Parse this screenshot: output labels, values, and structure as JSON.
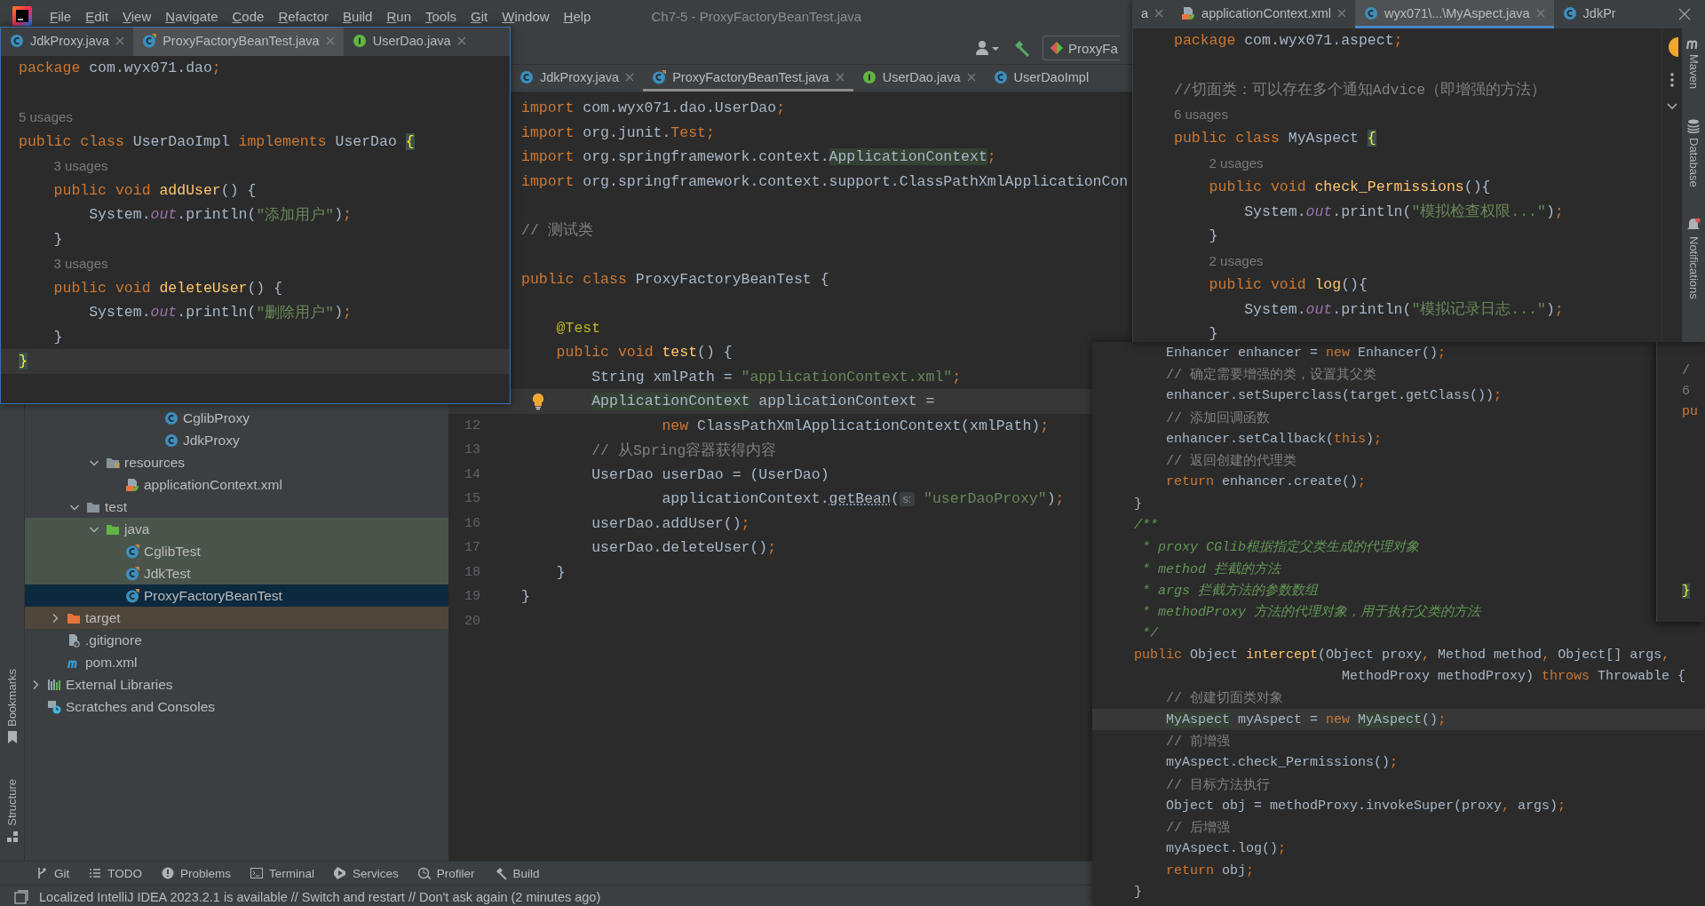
{
  "menu_bar": {
    "items": [
      "File",
      "Edit",
      "View",
      "Navigate",
      "Code",
      "Refactor",
      "Build",
      "Run",
      "Tools",
      "Git",
      "Window",
      "Help"
    ],
    "title": "Ch7-5 - ProxyFactoryBeanTest.java"
  },
  "toolbar": {
    "run_config": "ProxyFa"
  },
  "project_tree": [
    {
      "children": [
        {
          "children": [
            {
              "children": [
                {
                  "children": [
                    {
                      "children": [
                        {
                          "children": [
                            {
                              "label": "CglibProxy",
                              "kind": "class",
                              "selected": false
                            },
                            {
                              "label": "JdkProxy",
                              "kind": "class",
                              "selected": false
                            }
                          ]
                        }
                      ]
                    }
                  ]
                },
                {
                  "label": "resources",
                  "kind": "res-folder",
                  "expanded": true,
                  "selected": false,
                  "children": [
                    {
                      "label": "applicationContext.xml",
                      "kind": "xml",
                      "selected": false
                    }
                  ]
                }
              ]
            },
            {
              "label": "test",
              "kind": "folder",
              "expanded": true,
              "selected": false,
              "children": [
                {
                  "label": "java",
                  "kind": "test-folder",
                  "expanded": true,
                  "selected": false,
                  "children": [
                    {
                      "label": "CglibTest",
                      "kind": "test-class",
                      "selected": false
                    },
                    {
                      "label": "JdkTest",
                      "kind": "test-class",
                      "selected": false
                    },
                    {
                      "label": "ProxyFactoryBeanTest",
                      "kind": "test-class",
                      "selected": true
                    }
                  ]
                }
              ]
            }
          ]
        },
        {
          "label": "target",
          "kind": "excluded-folder",
          "expanded": false,
          "selected": false
        },
        {
          "label": ".gitignore",
          "kind": "ignore",
          "selected": false
        },
        {
          "label": "pom.xml",
          "kind": "maven",
          "selected": false
        }
      ]
    },
    {
      "label": "External Libraries",
      "kind": "libs",
      "expanded": false,
      "selected": false
    },
    {
      "label": "Scratches and Consoles",
      "kind": "scratch",
      "selected": false
    }
  ],
  "main_editor": {
    "tabs": [
      {
        "label": "JdkProxy.java",
        "kind": "class",
        "selected": false,
        "closable": true
      },
      {
        "label": "ProxyFactoryBeanTest.java",
        "kind": "test-class",
        "selected": true,
        "closable": true
      },
      {
        "label": "UserDao.java",
        "kind": "interface",
        "selected": false,
        "closable": true
      },
      {
        "label": "UserDaoImpl",
        "kind": "class",
        "selected": false,
        "closable": false
      }
    ],
    "lines": [
      {
        "t": [
          {
            "kind": "keyword",
            "text": "import "
          },
          {
            "kind": "plain",
            "text": "com.wyx071.dao.UserDao"
          },
          {
            "kind": "keyword",
            "text": ";"
          }
        ],
        "current": false
      },
      {
        "t": [
          {
            "kind": "keyword",
            "text": "import "
          },
          {
            "kind": "plain",
            "text": "org.junit."
          },
          {
            "kind": "keyword",
            "text": "Test"
          },
          {
            "kind": "keyword",
            "text": ";"
          }
        ],
        "current": false
      },
      {
        "t": [
          {
            "kind": "keyword",
            "text": "import "
          },
          {
            "kind": "plain",
            "text": "org.springframework.context."
          },
          {
            "kind": "highlight",
            "text": "ApplicationContext"
          },
          {
            "kind": "keyword",
            "text": ";"
          }
        ],
        "current": false
      },
      {
        "t": [
          {
            "kind": "keyword",
            "text": "import "
          },
          {
            "kind": "plain",
            "text": "org.springframework.context.support.ClassPathXmlApplicationCon"
          }
        ],
        "current": false
      },
      {
        "current": false
      },
      {
        "t": [
          {
            "kind": "comment",
            "text": "// 测试类"
          }
        ],
        "current": false
      },
      {
        "current": false
      },
      {
        "t": [
          {
            "kind": "keyword",
            "text": "public class "
          },
          {
            "kind": "plain",
            "text": "ProxyFactoryBeanTest {"
          }
        ],
        "current": false
      },
      {
        "current": false
      },
      {
        "t": [
          {
            "kind": "annotation",
            "text": "    @Test"
          }
        ],
        "current": false
      },
      {
        "t": [
          {
            "kind": "keyword",
            "text": "    public void "
          },
          {
            "kind": "function",
            "text": "test"
          },
          {
            "kind": "plain",
            "text": "() {"
          }
        ],
        "current": false
      },
      {
        "t": [
          {
            "kind": "plain",
            "text": "        String xmlPath = "
          },
          {
            "kind": "string",
            "text": "\"applicationContext.xml\""
          },
          {
            "kind": "keyword",
            "text": ";"
          }
        ],
        "current": false
      },
      {
        "t": [
          {
            "kind": "highlight",
            "text": "        ApplicationContext"
          },
          {
            "kind": "plain",
            "text": " applicationContext ="
          }
        ],
        "current": true
      },
      {
        "number": "12",
        "t": [
          {
            "kind": "keyword",
            "text": "                new "
          },
          {
            "kind": "plain",
            "text": "ClassPathXmlApplicationContext(xmlPath)"
          },
          {
            "kind": "keyword",
            "text": ";"
          }
        ],
        "current": false
      },
      {
        "number": "13",
        "t": [
          {
            "kind": "comment",
            "text": "        // 从Spring容器获得内容"
          }
        ],
        "current": false
      },
      {
        "number": "14",
        "t": [
          {
            "kind": "plain",
            "text": "        UserDao userDao = (UserDao)"
          }
        ],
        "current": false
      },
      {
        "number": "15",
        "t": [
          {
            "kind": "plain",
            "text": "                applicationContext."
          },
          {
            "kind": "warning",
            "text": "getBean"
          },
          {
            "kind": "plain",
            "text": "("
          },
          {
            "kind": "hint",
            "text": "s:"
          },
          {
            "kind": "string",
            "text": " \"userDaoProxy\""
          },
          {
            "kind": "plain",
            "text": ")"
          },
          {
            "kind": "keyword",
            "text": ";"
          }
        ],
        "current": false
      },
      {
        "number": "16",
        "t": [
          {
            "kind": "plain",
            "text": "        userDao.addUser()"
          },
          {
            "kind": "keyword",
            "text": ";"
          }
        ],
        "current": false
      },
      {
        "number": "17",
        "t": [
          {
            "kind": "plain",
            "text": "        userDao.deleteUser()"
          },
          {
            "kind": "keyword",
            "text": ";"
          }
        ],
        "current": false
      },
      {
        "number": "18",
        "t": [
          {
            "kind": "plain",
            "text": "    }"
          }
        ],
        "current": false
      },
      {
        "number": "19",
        "t": [
          {
            "kind": "plain",
            "text": "}"
          }
        ],
        "current": false
      },
      {
        "number": "20",
        "current": false
      }
    ]
  },
  "left_strip": [
    "Bookmarks",
    "Structure"
  ],
  "tool_windows": [
    {
      "label": "Git",
      "kind": "git"
    },
    {
      "label": "TODO",
      "kind": "todo"
    },
    {
      "label": "Problems",
      "kind": "problems"
    },
    {
      "label": "Terminal",
      "kind": "terminal"
    },
    {
      "label": "Services",
      "kind": "services"
    },
    {
      "label": "Profiler",
      "kind": "profiler"
    },
    {
      "label": "Build",
      "kind": "build"
    }
  ],
  "status_bar": {
    "message": "Localized IntelliJ IDEA 2023.2.1 is available // Switch and restart // Don't ask again (2 minutes ago)"
  },
  "dao_window": {
    "tabs": [
      {
        "label": "JdkProxy.java",
        "kind": "class",
        "selected": false,
        "closable": true
      },
      {
        "label": "ProxyFactoryBeanTest.java",
        "kind": "test-class",
        "selected": true,
        "closable": true
      },
      {
        "label": "UserDao.java",
        "kind": "interface",
        "selected": false,
        "closable": true
      }
    ],
    "lines": [
      {
        "t": [
          {
            "kind": "keyword",
            "text": "package "
          },
          {
            "kind": "plain",
            "text": "com.wyx071.dao"
          },
          {
            "kind": "keyword",
            "text": ";"
          }
        ],
        "current": false
      },
      {
        "current": false
      },
      {
        "t": [
          {
            "kind": "usages",
            "text": "5 usages"
          }
        ],
        "current": false
      },
      {
        "t": [
          {
            "kind": "keyword",
            "text": "public class "
          },
          {
            "kind": "plain",
            "text": "UserDaoImpl "
          },
          {
            "kind": "keyword",
            "text": "implements "
          },
          {
            "kind": "plain",
            "text": "UserDao "
          },
          {
            "kind": "brace",
            "text": "{"
          }
        ],
        "current": false
      },
      {
        "t": [
          {
            "kind": "usages",
            "text": "    3 usages"
          }
        ],
        "current": false
      },
      {
        "t": [
          {
            "kind": "keyword",
            "text": "    public void "
          },
          {
            "kind": "function",
            "text": "addUser"
          },
          {
            "kind": "plain",
            "text": "() {"
          }
        ],
        "current": false
      },
      {
        "t": [
          {
            "kind": "plain",
            "text": "        System."
          },
          {
            "kind": "field",
            "text": "out"
          },
          {
            "kind": "plain",
            "text": ".println("
          },
          {
            "kind": "string",
            "text": "\"添加用户\""
          },
          {
            "kind": "plain",
            "text": ")"
          },
          {
            "kind": "keyword",
            "text": ";"
          }
        ],
        "current": false
      },
      {
        "t": [
          {
            "kind": "plain",
            "text": "    }"
          }
        ],
        "current": false
      },
      {
        "t": [
          {
            "kind": "usages",
            "text": "    3 usages"
          }
        ],
        "current": false
      },
      {
        "t": [
          {
            "kind": "keyword",
            "text": "    public void "
          },
          {
            "kind": "function",
            "text": "deleteUser"
          },
          {
            "kind": "plain",
            "text": "() {"
          }
        ],
        "current": false
      },
      {
        "t": [
          {
            "kind": "plain",
            "text": "        System."
          },
          {
            "kind": "field",
            "text": "out"
          },
          {
            "kind": "plain",
            "text": ".println("
          },
          {
            "kind": "string",
            "text": "\"删除用户\""
          },
          {
            "kind": "plain",
            "text": ")"
          },
          {
            "kind": "keyword",
            "text": ";"
          }
        ],
        "current": false
      },
      {
        "t": [
          {
            "kind": "plain",
            "text": "    }"
          }
        ],
        "current": false
      },
      {
        "t": [
          {
            "kind": "brace",
            "text": "}"
          }
        ],
        "current": true
      }
    ]
  },
  "aspect_window": {
    "tabs": [
      {
        "label": "a",
        "kind": "none",
        "selected": false,
        "closable": true
      },
      {
        "label": "applicationContext.xml",
        "kind": "xml",
        "selected": false,
        "closable": true
      },
      {
        "label": "wyx071\\...\\MyAspect.java",
        "kind": "class",
        "selected": true,
        "closable": true
      },
      {
        "label": "JdkPr",
        "kind": "class",
        "selected": false,
        "closable": false
      }
    ],
    "lines": [
      {
        "t": [
          {
            "kind": "keyword",
            "text": "package "
          },
          {
            "kind": "plain",
            "text": "com.wyx071.aspect"
          },
          {
            "kind": "keyword",
            "text": ";"
          }
        ],
        "current": false
      },
      {
        "current": false
      },
      {
        "t": [
          {
            "kind": "comment",
            "text": "//切面类：可以存在多个通知Advice（即增强的方法）"
          }
        ],
        "current": false
      },
      {
        "t": [
          {
            "kind": "usages",
            "text": "6 usages"
          }
        ],
        "current": false
      },
      {
        "t": [
          {
            "kind": "keyword",
            "text": "public class "
          },
          {
            "kind": "plain",
            "text": "MyAspect "
          },
          {
            "kind": "brace",
            "text": "{"
          }
        ],
        "current": false
      },
      {
        "t": [
          {
            "kind": "usages",
            "text": "    2 usages"
          }
        ],
        "current": false
      },
      {
        "t": [
          {
            "kind": "keyword",
            "text": "    public void "
          },
          {
            "kind": "function",
            "text": "check_Permissions"
          },
          {
            "kind": "plain",
            "text": "(){"
          }
        ],
        "current": false
      },
      {
        "t": [
          {
            "kind": "plain",
            "text": "        System."
          },
          {
            "kind": "field",
            "text": "out"
          },
          {
            "kind": "plain",
            "text": ".println("
          },
          {
            "kind": "string",
            "text": "\"模拟检查权限...\""
          },
          {
            "kind": "plain",
            "text": ")"
          },
          {
            "kind": "keyword",
            "text": ";"
          }
        ],
        "current": false
      },
      {
        "t": [
          {
            "kind": "plain",
            "text": "    }"
          }
        ],
        "current": false
      },
      {
        "t": [
          {
            "kind": "usages",
            "text": "    2 usages"
          }
        ],
        "current": false
      },
      {
        "t": [
          {
            "kind": "keyword",
            "text": "    public void "
          },
          {
            "kind": "function",
            "text": "log"
          },
          {
            "kind": "plain",
            "text": "(){"
          }
        ],
        "current": false
      },
      {
        "t": [
          {
            "kind": "plain",
            "text": "        System."
          },
          {
            "kind": "field",
            "text": "out"
          },
          {
            "kind": "plain",
            "text": ".println("
          },
          {
            "kind": "string",
            "text": "\"模拟记录日志...\""
          },
          {
            "kind": "plain",
            "text": ")"
          },
          {
            "kind": "keyword",
            "text": ";"
          }
        ],
        "current": false
      },
      {
        "t": [
          {
            "kind": "plain",
            "text": "    }"
          }
        ],
        "current": false
      }
    ],
    "side_strip": [
      "Maven",
      "Database",
      "Notifications"
    ]
  },
  "cglib_window": {
    "lines": [
      {
        "t": [
          {
            "kind": "plain",
            "text": "    Enhancer enhancer = "
          },
          {
            "kind": "keyword",
            "text": "new "
          },
          {
            "kind": "plain",
            "text": "Enhancer()"
          },
          {
            "kind": "keyword",
            "text": ";"
          }
        ],
        "current": false
      },
      {
        "t": [
          {
            "kind": "comment",
            "text": "    // 确定需要增强的类，设置其父类"
          }
        ],
        "current": false
      },
      {
        "t": [
          {
            "kind": "plain",
            "text": "    enhancer.setSuperclass(target.getClass())"
          },
          {
            "kind": "keyword",
            "text": ";"
          }
        ],
        "current": false
      },
      {
        "t": [
          {
            "kind": "comment",
            "text": "    // 添加回调函数"
          }
        ],
        "current": false
      },
      {
        "t": [
          {
            "kind": "plain",
            "text": "    enhancer.setCallback("
          },
          {
            "kind": "keyword",
            "text": "this"
          },
          {
            "kind": "plain",
            "text": ")"
          },
          {
            "kind": "keyword",
            "text": ";"
          }
        ],
        "current": false
      },
      {
        "t": [
          {
            "kind": "comment",
            "text": "    // 返回创建的代理类"
          }
        ],
        "current": false
      },
      {
        "t": [
          {
            "kind": "keyword",
            "text": "    return "
          },
          {
            "kind": "plain",
            "text": "enhancer.create()"
          },
          {
            "kind": "keyword",
            "text": ";"
          }
        ],
        "current": false
      },
      {
        "t": [
          {
            "kind": "plain",
            "text": "}"
          }
        ],
        "current": false
      },
      {
        "t": [
          {
            "kind": "doc",
            "text": "/**"
          }
        ],
        "current": false
      },
      {
        "t": [
          {
            "kind": "doc",
            "text": " * proxy CGlib根据指定父类生成的代理对象"
          }
        ],
        "current": false
      },
      {
        "t": [
          {
            "kind": "doc",
            "text": " * method 拦截的方法"
          }
        ],
        "current": false
      },
      {
        "t": [
          {
            "kind": "doc",
            "text": " * args 拦截方法的参数数组"
          }
        ],
        "current": false
      },
      {
        "t": [
          {
            "kind": "doc",
            "text": " * methodProxy 方法的代理对象，用于执行父类的方法"
          }
        ],
        "current": false
      },
      {
        "t": [
          {
            "kind": "doc",
            "text": " */"
          }
        ],
        "current": false
      },
      {
        "t": [
          {
            "kind": "keyword",
            "text": "public "
          },
          {
            "kind": "plain",
            "text": "Object "
          },
          {
            "kind": "function",
            "text": "intercept"
          },
          {
            "kind": "plain",
            "text": "(Object proxy"
          },
          {
            "kind": "keyword",
            "text": ", "
          },
          {
            "kind": "plain",
            "text": "Method method"
          },
          {
            "kind": "keyword",
            "text": ", "
          },
          {
            "kind": "plain",
            "text": "Object[] args"
          },
          {
            "kind": "keyword",
            "text": ","
          }
        ],
        "current": false
      },
      {
        "t": [
          {
            "kind": "plain",
            "text": "                          MethodProxy methodProxy) "
          },
          {
            "kind": "keyword",
            "text": "throws "
          },
          {
            "kind": "plain",
            "text": "Throwable {"
          }
        ],
        "current": false
      },
      {
        "t": [
          {
            "kind": "comment",
            "text": "    // 创建切面类对象"
          }
        ],
        "current": false
      },
      {
        "t": [
          {
            "kind": "highlight",
            "text": "    MyAspect"
          },
          {
            "kind": "plain",
            "text": " myAspect = "
          },
          {
            "kind": "keyword",
            "text": "new "
          },
          {
            "kind": "highlight",
            "text": "MyAspect"
          },
          {
            "kind": "plain",
            "text": "()"
          },
          {
            "kind": "keyword",
            "text": ";"
          }
        ],
        "current": true
      },
      {
        "t": [
          {
            "kind": "comment",
            "text": "    // 前增强"
          }
        ],
        "current": false
      },
      {
        "t": [
          {
            "kind": "plain",
            "text": "    myAspect.check_Permissions()"
          },
          {
            "kind": "keyword",
            "text": ";"
          }
        ],
        "current": false
      },
      {
        "t": [
          {
            "kind": "comment",
            "text": "    // 目标方法执行"
          }
        ],
        "current": false
      },
      {
        "t": [
          {
            "kind": "plain",
            "text": "    Object obj = methodProxy.invokeSuper(proxy"
          },
          {
            "kind": "keyword",
            "text": ", "
          },
          {
            "kind": "plain",
            "text": "args)"
          },
          {
            "kind": "keyword",
            "text": ";"
          }
        ],
        "current": false
      },
      {
        "t": [
          {
            "kind": "comment",
            "text": "    // 后增强"
          }
        ],
        "current": false
      },
      {
        "t": [
          {
            "kind": "plain",
            "text": "    myAspect.log()"
          },
          {
            "kind": "keyword",
            "text": ";"
          }
        ],
        "current": false
      },
      {
        "t": [
          {
            "kind": "keyword",
            "text": "    return "
          },
          {
            "kind": "plain",
            "text": "obj"
          },
          {
            "kind": "keyword",
            "text": ";"
          }
        ],
        "current": false
      },
      {
        "t": [
          {
            "kind": "plain",
            "text": "}"
          }
        ],
        "current": false
      }
    ],
    "fragment": [
      {
        "text": "/",
        "kind": "comment"
      },
      {
        "text": "6",
        "kind": "usages"
      },
      {
        "text": "pu",
        "kind": "keyword"
      },
      {
        "text": "}",
        "kind": "brace"
      }
    ]
  }
}
